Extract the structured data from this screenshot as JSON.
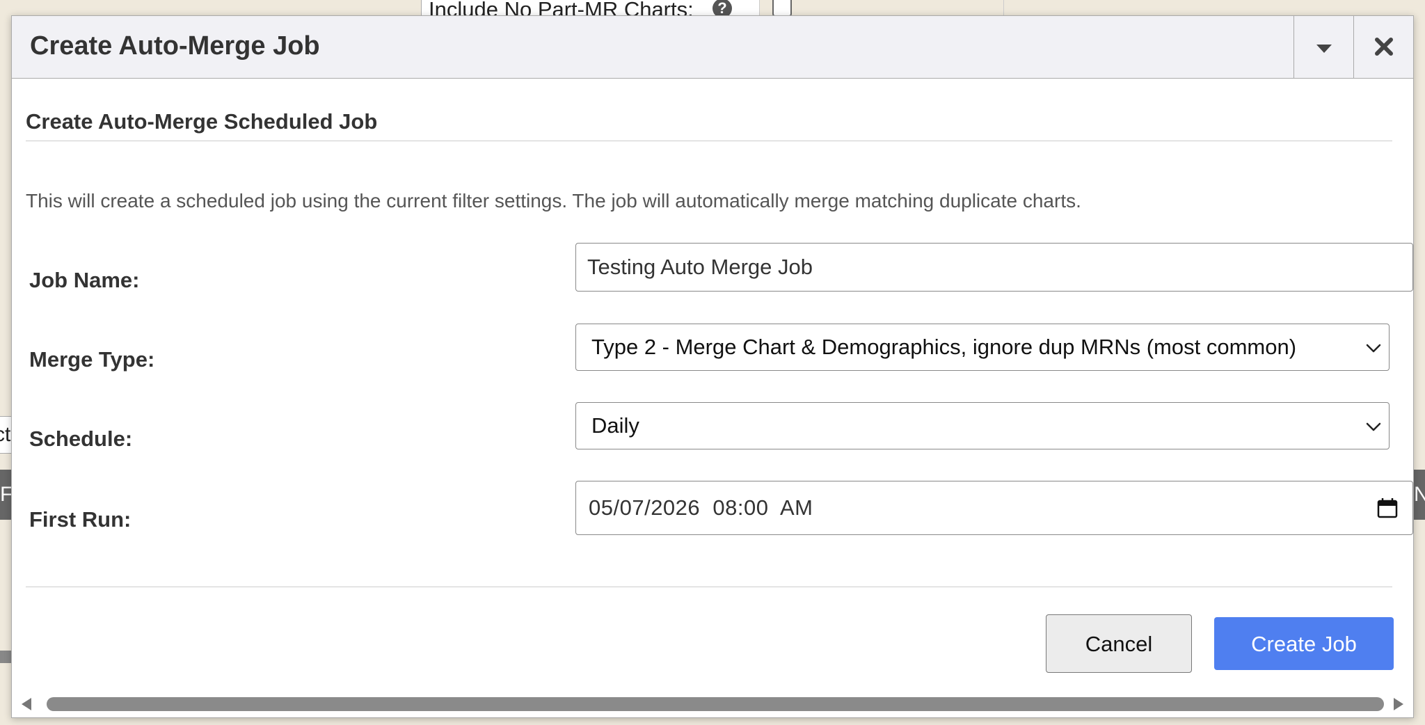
{
  "background": {
    "filter_label": "Include No Part-MR Charts:",
    "left_fragment_1": "ct",
    "left_fragment_2": "F",
    "right_fragment": "N"
  },
  "dialog": {
    "title": "Create Auto-Merge Job",
    "section_title": "Create Auto-Merge Scheduled Job",
    "description": "This will create a scheduled job using the current filter settings. The job will automatically merge matching duplicate charts.",
    "form": {
      "job_name_label": "Job Name:",
      "job_name_value": "Testing Auto Merge Job",
      "merge_type_label": "Merge Type:",
      "merge_type_value": "Type 2 - Merge Chart & Demographics, ignore dup MRNs (most common)",
      "schedule_label": "Schedule:",
      "schedule_value": "Daily",
      "first_run_label": "First Run:",
      "first_run_value": "05/07/2026  08:00  AM"
    },
    "buttons": {
      "cancel": "Cancel",
      "create": "Create Job"
    }
  },
  "colors": {
    "primary_button": "#4f7ff0",
    "titlebar_bg": "#f1f1f5",
    "page_bg": "#efe9dc"
  }
}
